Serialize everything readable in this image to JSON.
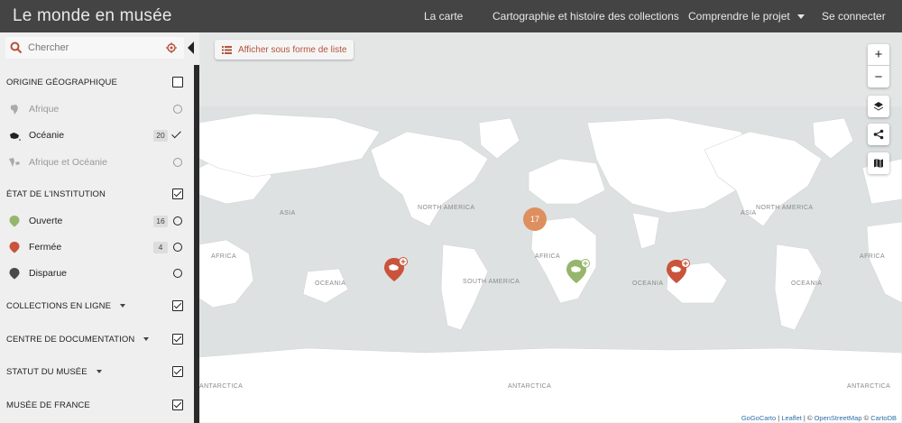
{
  "header": {
    "brand": "Le monde en musée",
    "nav": [
      {
        "label": "La carte"
      },
      {
        "label": "Cartographie et histoire des collections"
      },
      {
        "label": "Comprendre le projet"
      },
      {
        "label": "Se connecter"
      }
    ]
  },
  "sidebar": {
    "search_placeholder": "Chercher",
    "origine": {
      "title": "ORIGINE GÉOGRAPHIQUE",
      "items": [
        {
          "label": "Afrique"
        },
        {
          "label": "Océanie",
          "count": "20"
        },
        {
          "label": "Afrique et Océanie"
        }
      ]
    },
    "etat": {
      "title": "ÉTAT DE L'INSTITUTION",
      "items": [
        {
          "label": "Ouverte",
          "count": "16",
          "color": "#95b66c"
        },
        {
          "label": "Fermée",
          "count": "4",
          "color": "#c9543b"
        },
        {
          "label": "Disparue",
          "color": "#4a4a4a"
        }
      ]
    },
    "filters": [
      {
        "label": "COLLECTIONS EN LIGNE"
      },
      {
        "label": "CENTRE DE DOCUMENTATION"
      },
      {
        "label": "STATUT DU MUSÉE"
      },
      {
        "label": "MUSÉE DE FRANCE"
      }
    ]
  },
  "map": {
    "list_button": "Afficher sous forme de liste",
    "zoom_in": "+",
    "zoom_out": "−",
    "cluster_count": "17",
    "cluster_color": "#de8f5f",
    "labels": {
      "asia": "ASIA",
      "africa": "AFRICA",
      "oceania": "OCEANIA",
      "north_america": "NORTH AMERICA",
      "south_america": "SOUTH AMERICA",
      "antarctica": "ANTARCTICA"
    },
    "attribution": {
      "gogocarto": "GoGoCarto",
      "sep1": " | ",
      "leaflet": "Leaflet",
      "sep2": " | © ",
      "osm": "OpenStreetMap",
      "sep3": " © ",
      "carto": "CartoDB"
    }
  },
  "colors": {
    "accent": "#b5533c",
    "topbar": "#444444",
    "ocean": "#dde1e1",
    "land": "#ffffff"
  }
}
